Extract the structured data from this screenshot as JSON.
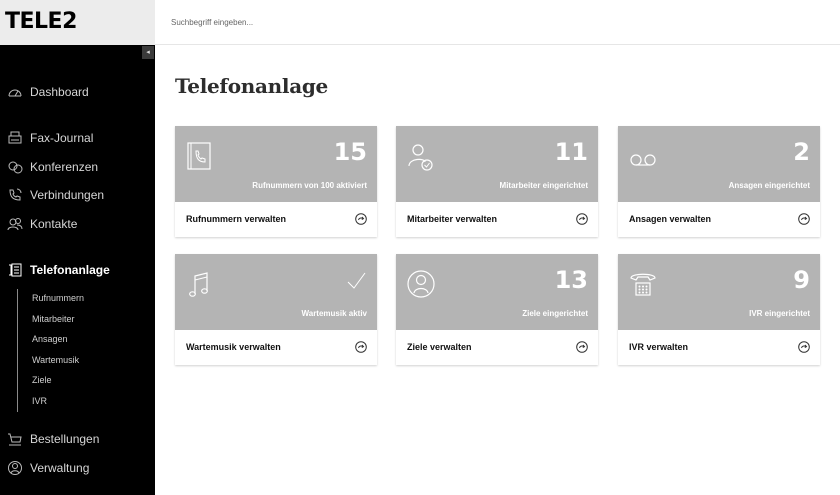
{
  "brand": {
    "logo_text": "TELE2",
    "accent": "#000000",
    "card_gray": "#b4b4b4"
  },
  "header": {
    "search_placeholder": "Suchbegriff eingeben..."
  },
  "sidebar": {
    "collapse_glyph": "◂",
    "items": [
      {
        "label": "Dashboard",
        "icon": "gauge-icon"
      },
      {
        "label": "Fax-Journal",
        "icon": "fax-icon"
      },
      {
        "label": "Konferenzen",
        "icon": "conference-icon"
      },
      {
        "label": "Verbindungen",
        "icon": "phone-call-icon"
      },
      {
        "label": "Kontakte",
        "icon": "contacts-icon"
      },
      {
        "label": "Telefonanlage",
        "icon": "phone-system-icon",
        "active": true
      },
      {
        "label": "Bestellungen",
        "icon": "cart-icon"
      },
      {
        "label": "Verwaltung",
        "icon": "admin-icon"
      }
    ],
    "subitems": [
      "Rufnummern",
      "Mitarbeiter",
      "Ansagen",
      "Wartemusik",
      "Ziele",
      "IVR"
    ]
  },
  "main": {
    "title": "Telefonanlage",
    "cards": [
      {
        "number": "15",
        "desc": "Rufnummern von 100 aktiviert",
        "action": "Rufnummern verwalten",
        "icon": "phonebook-icon"
      },
      {
        "number": "11",
        "desc": "Mitarbeiter eingerichtet",
        "action": "Mitarbeiter verwalten",
        "icon": "user-check-icon"
      },
      {
        "number": "2",
        "desc": "Ansagen eingerichtet",
        "action": "Ansagen verwalten",
        "icon": "voicemail-icon"
      },
      {
        "number": "",
        "desc": "Wartemusik aktiv",
        "action": "Wartemusik verwalten",
        "icon": "music-note-icon",
        "checked": true
      },
      {
        "number": "13",
        "desc": "Ziele eingerichtet",
        "action": "Ziele verwalten",
        "icon": "user-circle-icon"
      },
      {
        "number": "9",
        "desc": "IVR eingerichtet",
        "action": "IVR verwalten",
        "icon": "desk-phone-icon"
      }
    ]
  }
}
